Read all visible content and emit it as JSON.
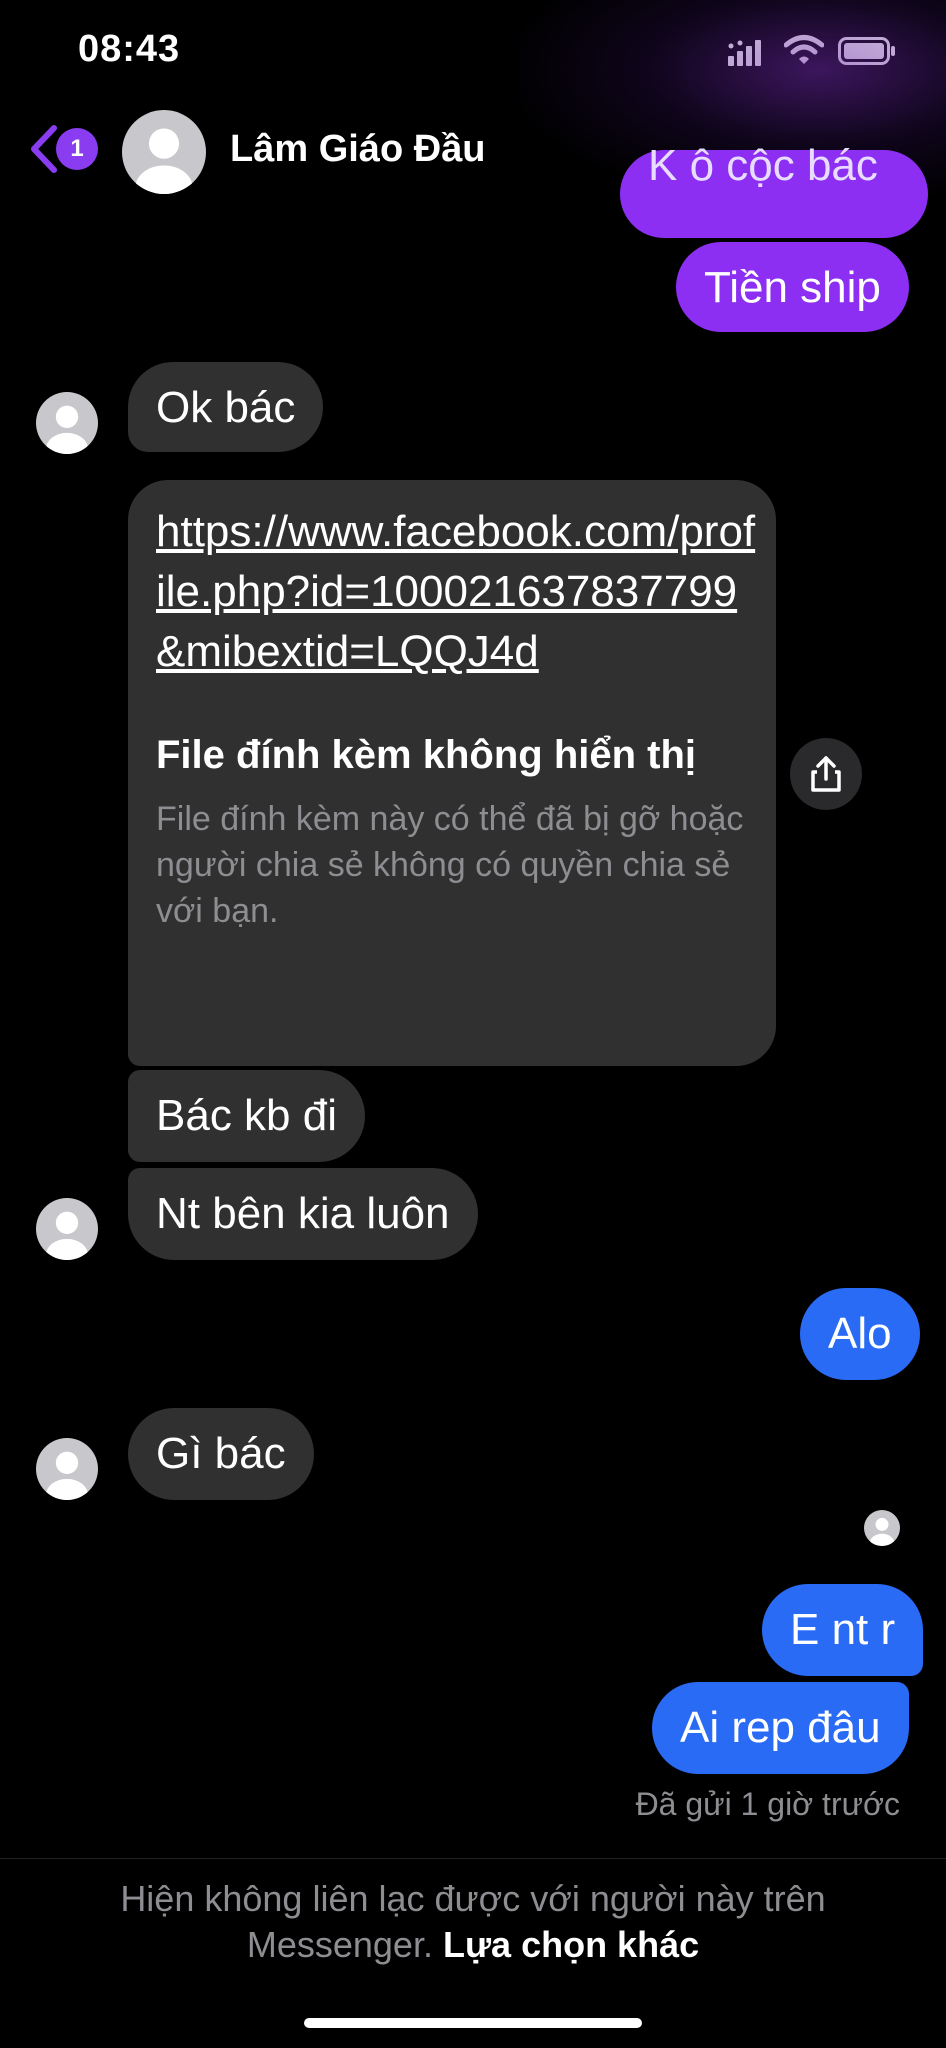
{
  "status_bar": {
    "time": "08:43"
  },
  "header": {
    "unread_count": "1",
    "contact_name": "Lâm Giáo Đầu"
  },
  "messages": {
    "clipped_top": "K ô cộc bác",
    "tien_ship": "Tiền ship",
    "ok_bac": "Ok bác",
    "link_card": {
      "url": "https://www.facebook.com/profile.php?id=100021637837799&mibextid=LQQJ4d",
      "title": "File đính kèm không hiển thị",
      "description": "File đính kèm này có thể đã bị gỡ hoặc người chia sẻ không có quyền chia sẻ với bạn."
    },
    "bac_kb_di": "Bác kb đi",
    "nt_ben_kia": "Nt bên kia luôn",
    "alo": "Alo",
    "gi_bac": "Gì bác",
    "e_nt_r": "E nt r",
    "ai_rep_dau": "Ai rep đâu",
    "sent_status": "Đã gửi 1 giờ trước"
  },
  "footer": {
    "notice": "Hiện không liên lạc được với người này trên Messenger.",
    "more_options": "Lựa chọn khác"
  },
  "colors": {
    "background": "#000000",
    "incoming_bubble": "#303030",
    "outgoing_purple": "#8c2ff2",
    "outgoing_blue": "#2a6bf5",
    "accent": "#8a3df0",
    "muted_text": "#8d8d92"
  }
}
